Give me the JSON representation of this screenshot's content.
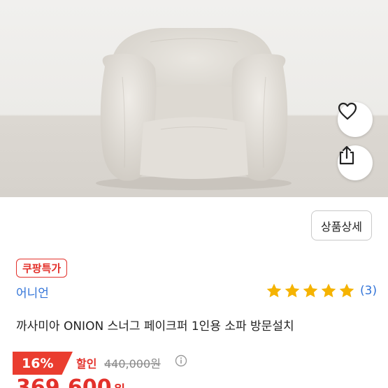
{
  "product": {
    "title": "까사미아 ONION 스너그 페이크퍼 1인용 소파 방문설치",
    "brand": "어니언",
    "badge": "쿠팡특가",
    "rating": {
      "stars": 5,
      "count": "(3)"
    },
    "detail_button": "상품상세"
  },
  "pricing": {
    "discount": "16%",
    "sale_label": "할인",
    "original_price": "440,000원",
    "price": "369,600",
    "currency_unit": "원"
  },
  "icons": {
    "like": "heart-icon",
    "share": "share-icon",
    "info": "info-icon",
    "star": "star-icon"
  },
  "colors": {
    "accent_red": "#e3312b",
    "link_blue": "#3475d8",
    "star_yellow": "#f5b301"
  }
}
